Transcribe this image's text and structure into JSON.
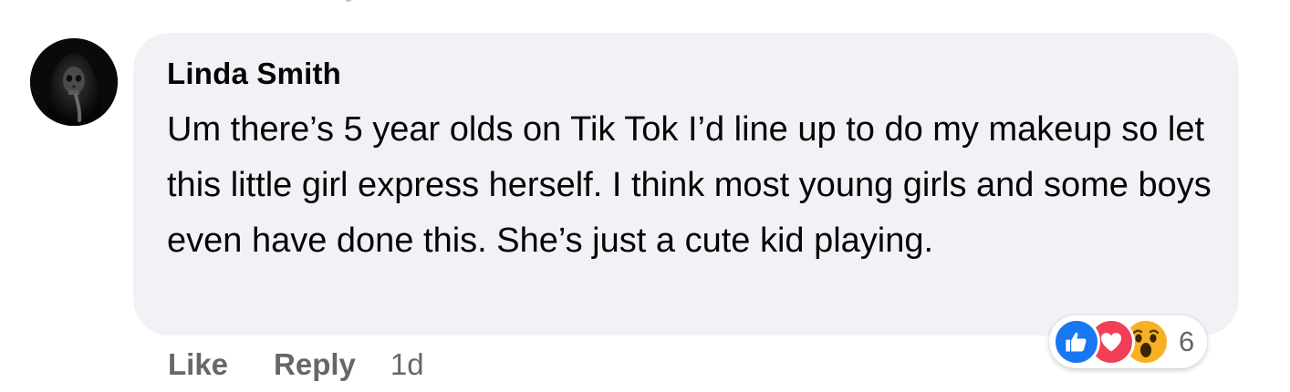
{
  "comment": {
    "author": "Linda Smith",
    "text": "Um there’s 5 year olds on Tik Tok I’d line up to do my makeup so let this little girl express herself. I think most young girls and some boys even have done this. She’s just a cute kid playing.",
    "actions": {
      "like_label": "Like",
      "reply_label": "Reply",
      "timestamp": "1d"
    },
    "reactions": {
      "icons": [
        "like-icon",
        "love-icon",
        "wow-icon"
      ],
      "count": "6"
    }
  },
  "colors": {
    "bubble_bg": "#f0f2f5",
    "text_primary": "#050505",
    "text_secondary": "#65676b",
    "like_blue": "#1877f2",
    "love_red": "#f33e58",
    "wow_yellow": "#f7b125"
  }
}
